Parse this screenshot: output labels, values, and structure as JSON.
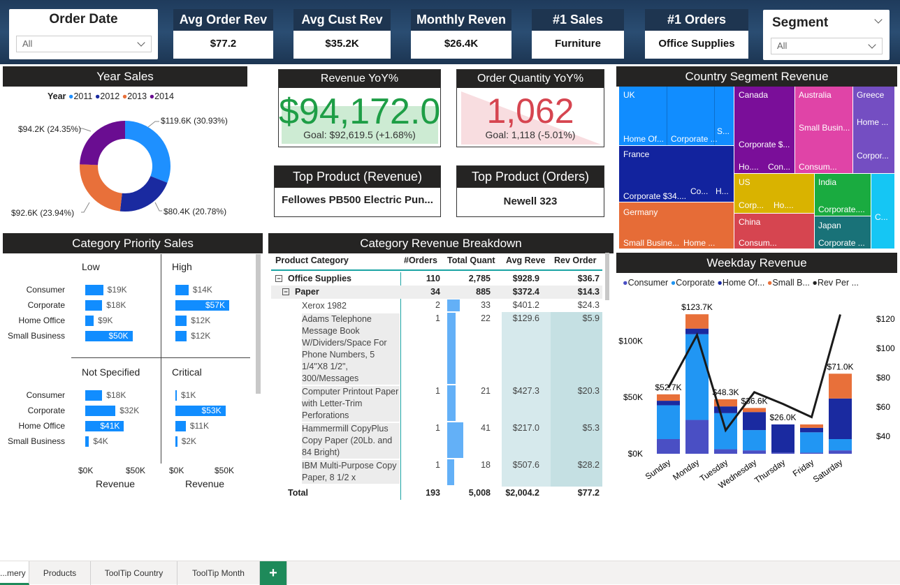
{
  "slicers": {
    "order_date": {
      "title": "Order Date",
      "value": "All"
    },
    "segment": {
      "title": "Segment",
      "value": "All"
    }
  },
  "kpis": [
    {
      "label": "Avg Order Rev",
      "value": "$77.2"
    },
    {
      "label": "Avg Cust Rev",
      "value": "$35.2K"
    },
    {
      "label": "Monthly Reven",
      "value": "$26.4K"
    },
    {
      "label": "#1 Sales",
      "value": "Furniture"
    },
    {
      "label": "#1 Orders",
      "value": "Office Supplies"
    }
  ],
  "year_sales": {
    "title": "Year Sales",
    "legend_title": "Year",
    "legend": [
      "2011",
      "2012",
      "2013",
      "2014"
    ],
    "labels": [
      "$119.6K (30.93%)",
      "$80.4K (20.78%)",
      "$92.6K (23.94%)",
      "$94.2K (24.35%)"
    ]
  },
  "revenue_yoy": {
    "title": "Revenue YoY%",
    "value": "$94,172.0",
    "goal": "Goal: $92,619.5 (+1.68%)"
  },
  "order_qty_yoy": {
    "title": "Order Quantity YoY%",
    "value": "1,062",
    "goal": "Goal: 1,118 (-5.01%)"
  },
  "top_product_rev": {
    "title": "Top Product (Revenue)",
    "value": "Fellowes PB500 Electric Pun..."
  },
  "top_product_ord": {
    "title": "Top Product (Orders)",
    "value": "Newell 323"
  },
  "country_treemap": {
    "title": "Country Segment Revenue",
    "labels": {
      "uk": "UK",
      "uk_home": "Home Of...",
      "uk_corp": "Corporate ...",
      "uk_s": "S...",
      "canada": "Canada",
      "canada_corp": "Corporate $...",
      "canada_ho": "Ho....",
      "canada_con": "Con...",
      "australia": "Australia",
      "australia_sb": "Small Busin...",
      "australia_con": "Consum...",
      "greece": "Greece",
      "greece_home": "Home ...",
      "greece_corp": "Corpor...",
      "france": "France",
      "france_corp": "Corporate $34....",
      "france_co": "Co...",
      "france_h": "H...",
      "us": "US",
      "us_corp": "Corp...",
      "us_ho": "Ho....",
      "india": "India",
      "india_corp": "Corporate....",
      "germany": "Germany",
      "germany_sb": "Small Busine...",
      "germany_home": "Home ...",
      "china": "China",
      "china_con": "Consum...",
      "japan": "Japan",
      "japan_corp": "Corporate ...",
      "c": "C..."
    }
  },
  "category_priority": {
    "title": "Category Priority Sales",
    "panels": [
      "Low",
      "High",
      "Not Specified",
      "Critical"
    ],
    "categories": [
      "Consumer",
      "Corporate",
      "Home Office",
      "Small Business"
    ],
    "values": [
      [
        "$19K",
        "$18K",
        "$9K",
        "$50K"
      ],
      [
        "$14K",
        "$57K",
        "$12K",
        "$12K"
      ],
      [
        "$18K",
        "$32K",
        "$41K",
        "$4K"
      ],
      [
        "$1K",
        "$53K",
        "$11K",
        "$2K"
      ]
    ],
    "axis_ticks": [
      "$0K",
      "$50K"
    ],
    "axis_label": "Revenue"
  },
  "breakdown": {
    "title": "Category Revenue Breakdown",
    "headers": [
      "Product Category",
      "#Orders",
      "Total Quant",
      "Avg Reve",
      "Rev Order"
    ],
    "l1": {
      "name": "Office Supplies",
      "orders": "110",
      "qty": "2,785",
      "avg": "$928.9",
      "rev": "$36.7"
    },
    "l2": {
      "name": "Paper",
      "orders": "34",
      "qty": "885",
      "avg": "$372.4",
      "rev": "$14.3"
    },
    "rows": [
      {
        "name": "Xerox 1982",
        "orders": "2",
        "qty": "33",
        "avg": "$401.2",
        "rev": "$24.3"
      },
      {
        "name": "Adams Telephone Message Book W/Dividers/Space For Phone Numbers, 5 1/4\"X8 1/2\", 300/Messages",
        "orders": "1",
        "qty": "22",
        "avg": "$129.6",
        "rev": "$5.9"
      },
      {
        "name": "Computer Printout Paper with Letter-Trim Perforations",
        "orders": "1",
        "qty": "21",
        "avg": "$427.3",
        "rev": "$20.3"
      },
      {
        "name": "Hammermill CopyPlus Copy Paper (20Lb. and 84 Bright)",
        "orders": "1",
        "qty": "41",
        "avg": "$217.0",
        "rev": "$5.3"
      },
      {
        "name": "IBM Multi-Purpose Copy Paper, 8 1/2 x",
        "orders": "1",
        "qty": "18",
        "avg": "$507.6",
        "rev": "$28.2"
      }
    ],
    "total": {
      "name": "Total",
      "orders": "193",
      "qty": "5,008",
      "avg": "$2,004.2",
      "rev": "$77.2"
    }
  },
  "chart_data": {
    "type": "bar",
    "title": "Weekday Revenue",
    "categories": [
      "Sunday",
      "Monday",
      "Tuesday",
      "Wednesday",
      "Thursday",
      "Friday",
      "Saturday"
    ],
    "series": [
      {
        "name": "Consumer",
        "color": "#4a4fc4",
        "values": [
          13,
          30,
          4,
          3,
          1,
          1,
          3
        ]
      },
      {
        "name": "Corporate",
        "color": "#2196f3",
        "values": [
          30,
          76,
          32,
          18,
          0,
          18,
          10
        ]
      },
      {
        "name": "Home Of...",
        "color": "#1a2aa0",
        "values": [
          4,
          5,
          6,
          16,
          25,
          4,
          36
        ]
      },
      {
        "name": "Small B...",
        "color": "#e8703a",
        "values": [
          5.7,
          12.7,
          6.3,
          3.6,
          0,
          3,
          22
        ]
      }
    ],
    "line": {
      "name": "Rev Per ...",
      "values": [
        73,
        109,
        44,
        70,
        62,
        53,
        123
      ]
    },
    "totals": [
      "$52.7K",
      "$123.7K",
      "$48.3K",
      "$36.6K",
      "$26.0K",
      "",
      "$71.0K"
    ],
    "y_ticks": [
      "$0K",
      "$50K",
      "$100K"
    ],
    "y2_ticks": [
      "$40",
      "$60",
      "$80",
      "$100",
      "$120"
    ],
    "ylim": [
      0,
      130
    ],
    "y2lim": [
      28,
      128
    ]
  },
  "tabs": [
    "...mery",
    "Products",
    "ToolTip Country",
    "ToolTip Month"
  ],
  "colors": {
    "y2011": "#1e90ff",
    "y2012": "#1a2aa0",
    "y2013": "#e8703a",
    "y2014": "#6a0d91"
  }
}
